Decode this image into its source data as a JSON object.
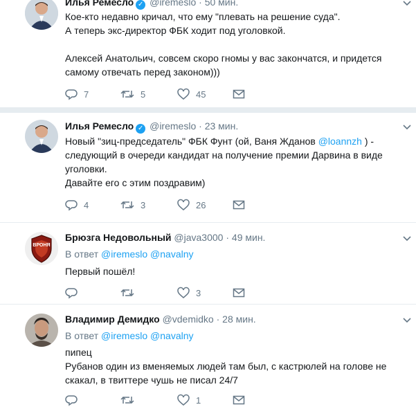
{
  "tweets": [
    {
      "name": "Илья Ремесло",
      "verified": true,
      "handle": "@iremeslo",
      "time": "50 мин.",
      "lines": [
        "Кое-кто недавно кричал, что ему \"плевать на решение суда\".",
        "А теперь экс-директор ФБК ходит под уголовкой.",
        "",
        "Алексей Анатольич, совсем скоро гномы у вас закончатся, и придется",
        "самому отвечать перед законом)))"
      ],
      "replies": "7",
      "retweets": "5",
      "likes": "45"
    },
    {
      "name": "Илья Ремесло",
      "verified": true,
      "handle": "@iremeslo",
      "time": "23 мин.",
      "line1_pre": "Новый \"зиц-председатель\" ФБК Фунт (ой, Ваня Жданов ",
      "line1_mention": "@loannzh",
      "line1_post": " ) -",
      "lines": [
        "следующий в очереди кандидат на получение премии Дарвина в виде",
        "уголовки.",
        "Давайте его с этим поздравим)"
      ],
      "replies": "4",
      "retweets": "3",
      "likes": "26"
    },
    {
      "name": "Брюзга Недовольный",
      "handle": "@java3000",
      "time": "49 мин.",
      "reply_prefix": "В ответ",
      "reply_to": [
        "@iremeslo",
        "@navalny"
      ],
      "lines": [
        "Первый пошёл!"
      ],
      "replies": "",
      "retweets": "",
      "likes": "3"
    },
    {
      "name": "Владимир Демидко",
      "handle": "@vdemidko",
      "time": "28 мин.",
      "reply_prefix": "В ответ",
      "reply_to": [
        "@iremeslo",
        "@navalny"
      ],
      "lines": [
        "пипец",
        "Рубанов один из вменяемых людей там был, с кастрюлей на голове не",
        "скакал, в твиттере чушь не писал 24/7"
      ],
      "replies": "",
      "retweets": "",
      "likes": "1"
    }
  ],
  "avatar3_badge": "ВРОНЯ",
  "colors": {
    "accent": "#1da1f2",
    "muted": "#657786",
    "separator": "#e6ecf0",
    "text": "#14171a"
  },
  "icons": [
    "reply-icon",
    "retweet-icon",
    "like-icon",
    "direct-message-icon",
    "chevron-down-icon",
    "verified-badge-icon"
  ]
}
